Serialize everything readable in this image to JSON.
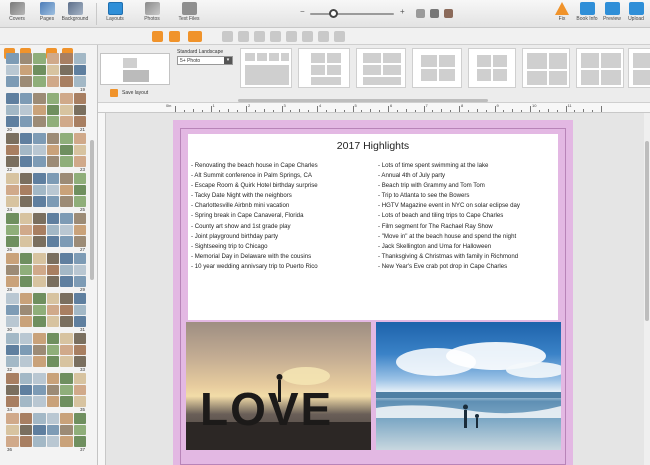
{
  "toolbar": {
    "covers": "Covers",
    "pages": "Pages",
    "background": "Background",
    "layouts": "Layouts",
    "photos": "Photos",
    "text_files": "Text Files",
    "fix": "Fix",
    "book_info": "Book Info",
    "preview": "Preview",
    "upload": "Upload"
  },
  "zoom": {
    "level": 0.25
  },
  "layout_panel": {
    "format_label": "Standard Landscape",
    "format_value": "5+ Photo",
    "save_layout": "Save layout"
  },
  "ruler": {
    "unit": "0in",
    "marks": [
      "1",
      "2",
      "3",
      "4",
      "5",
      "6",
      "7",
      "8",
      "9",
      "10",
      "11"
    ]
  },
  "thumbnails": {
    "numbers": [
      [
        "",
        "19"
      ],
      [
        "20",
        "21"
      ],
      [
        "22",
        "23"
      ],
      [
        "24",
        "25"
      ],
      [
        "26",
        "27"
      ],
      [
        "28",
        "29"
      ],
      [
        "30",
        "31"
      ],
      [
        "32",
        "33"
      ],
      [
        "34",
        "35"
      ],
      [
        "36",
        "37"
      ]
    ]
  },
  "page": {
    "title": "2017 Highlights",
    "left_items": [
      "- Renovating the beach house in Cape Charles",
      "- Alt Summit conference in Palm Springs, CA",
      "- Escape Room & Quirk Hotel birthday surprise",
      "- Tacky Date Night with the neighbors",
      "- Charlottesville Airbnb mini vacation",
      "- Spring break in Cape Canaveral, Florida",
      "- County art show and 1st grade play",
      "- Joint playground birthday party",
      "- Sightseeing trip to Chicago",
      "- Memorial Day in Delaware with the cousins",
      "- 10 year wedding annivsary trip to Puerto Rico"
    ],
    "right_items": [
      "- Lots of time spent swimming at the lake",
      "- Annual 4th of July party",
      "- Beach trip with Grammy and Tom Tom",
      "- Trip to Atlanta to see the Bowers",
      "- HGTV Magazine event in NYC on solar eclipse day",
      "- Lots of beach and tiling trips to Cape Charles",
      "- Film segment for The Rachael Ray Show",
      "- \"Move in\" at the beach house and spend the night",
      "- Jack Skellington and Uma for Halloween",
      "- Thanksgiving & Christmas with family in Richmond",
      "- New Year's Eve crab pot drop in Cape Charles"
    ],
    "photo1_word": "LOVE"
  },
  "colors": {
    "page_background": "#e3b8e3",
    "accent_orange": "#f0932b",
    "accent_blue": "#2f8fd8"
  }
}
